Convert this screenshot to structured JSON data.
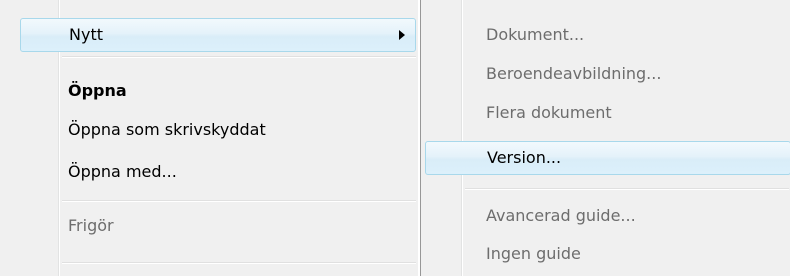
{
  "main_menu": {
    "items": [
      {
        "label": "Nytt",
        "state": "highlighted",
        "has_submenu": true
      },
      {
        "label": "Öppna",
        "state": "bold-default"
      },
      {
        "label": "Öppna som skrivskyddat",
        "state": "normal"
      },
      {
        "label": "Öppna med...",
        "state": "normal"
      },
      {
        "label": "Frigör",
        "state": "disabled"
      }
    ]
  },
  "submenu": {
    "items": [
      {
        "label": "Dokument...",
        "state": "disabled"
      },
      {
        "label": "Beroendeavbildning...",
        "state": "disabled"
      },
      {
        "label": "Flera dokument",
        "state": "disabled"
      },
      {
        "label": "Version...",
        "state": "highlighted"
      },
      {
        "label": "Avancerad guide...",
        "state": "disabled"
      },
      {
        "label": "Ingen guide",
        "state": "disabled"
      }
    ]
  },
  "colors": {
    "menu_background": "#f0f0f0",
    "highlight_border": "#a8d8eb",
    "highlight_fill": "#dcf0fb",
    "disabled_text": "#6d6d6d",
    "gutter_line": "#e2e3e3"
  },
  "icons": {
    "submenu_arrow": "chevron-right-icon"
  }
}
